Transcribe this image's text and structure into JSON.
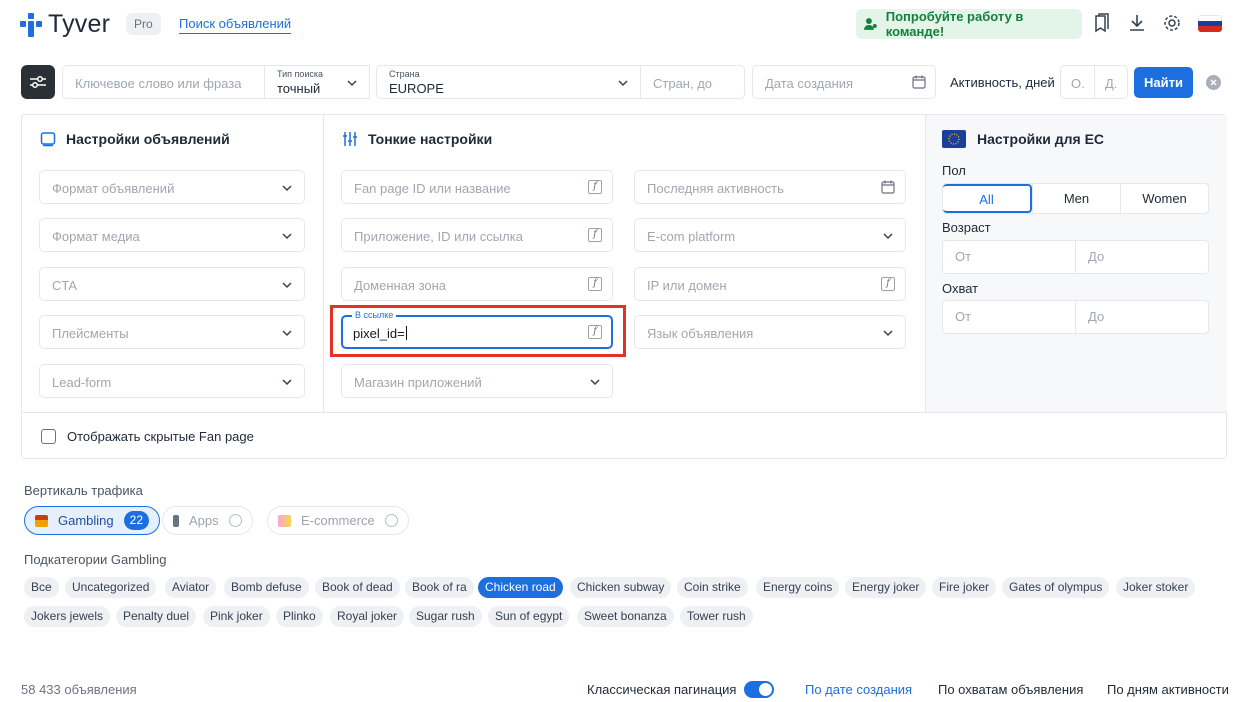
{
  "header": {
    "logo": "Tyver",
    "badge": "Pro",
    "nav_link": "Поиск объявлений",
    "team_button": "Попробуйте работу в команде!",
    "icons": [
      "bookmarks-icon",
      "download-icon",
      "settings-icon",
      "russia-flag-icon"
    ]
  },
  "search": {
    "keyword_placeholder": "Ключевое слово или фраза",
    "search_type_label": "Тип поиска",
    "search_type_value": "точный",
    "country_label": "Страна",
    "country_value": "EUROPE",
    "countries_placeholder": "Стран, до",
    "date_placeholder": "Дата создания",
    "activity_label": "Активность, дней",
    "activity_from": "О.",
    "activity_to": "Д.",
    "find_button": "Найти"
  },
  "ad_settings": {
    "title": "Настройки объявлений",
    "fields": [
      "Формат объявлений",
      "Формат медиа",
      "CTA",
      "Плейсменты",
      "Lead-form"
    ]
  },
  "fine_settings": {
    "title": "Тонкие настройки",
    "col1": [
      "Fan page ID или название",
      "Приложение, ID или ссылка",
      "Доменная зона"
    ],
    "link_label": "В ссылке",
    "link_value": "pixel_id=",
    "store_placeholder": "Магазин приложений",
    "col2": [
      "Последняя активность",
      "E-com platform",
      "IP или домен",
      "Язык объявления"
    ]
  },
  "eu_settings": {
    "title": "Настройки для ЕС",
    "gender_label": "Пол",
    "gender_options": [
      "All",
      "Men",
      "Women"
    ],
    "age_label": "Возраст",
    "reach_label": "Охват",
    "from": "От",
    "to": "До"
  },
  "hidden_fanpage_label": "Отображать скрытые Fan page",
  "verticals": {
    "title": "Вертикаль трафика",
    "items": [
      {
        "label": "Gambling",
        "count": "22"
      },
      {
        "label": "Apps"
      },
      {
        "label": "E-commerce"
      }
    ]
  },
  "subcategories": {
    "title": "Подкатегории Gambling",
    "row1": [
      "Все",
      "Uncategorized",
      "Aviator",
      "Bomb defuse",
      "Book of dead",
      "Book of ra",
      "Chicken road",
      "Chicken subway",
      "Coin strike",
      "Energy coins",
      "Energy joker",
      "Fire joker",
      "Gates of olympus",
      "Joker stoker"
    ],
    "row2": [
      "Jokers jewels",
      "Penalty duel",
      "Pink joker",
      "Plinko",
      "Royal joker",
      "Sugar rush",
      "Sun of egypt",
      "Sweet bonanza",
      "Tower rush"
    ],
    "selected": "Chicken road"
  },
  "footer": {
    "count": "58 433 объявления",
    "pagination_label": "Классическая пагинация",
    "sort_by_date": "По дате создания",
    "sort_by_reach": "По охватам объявления",
    "sort_by_activity": "По дням активности"
  },
  "colors": {
    "accent": "#1d6fe0",
    "highlight": "#e53124",
    "team_green": "#15803d"
  }
}
